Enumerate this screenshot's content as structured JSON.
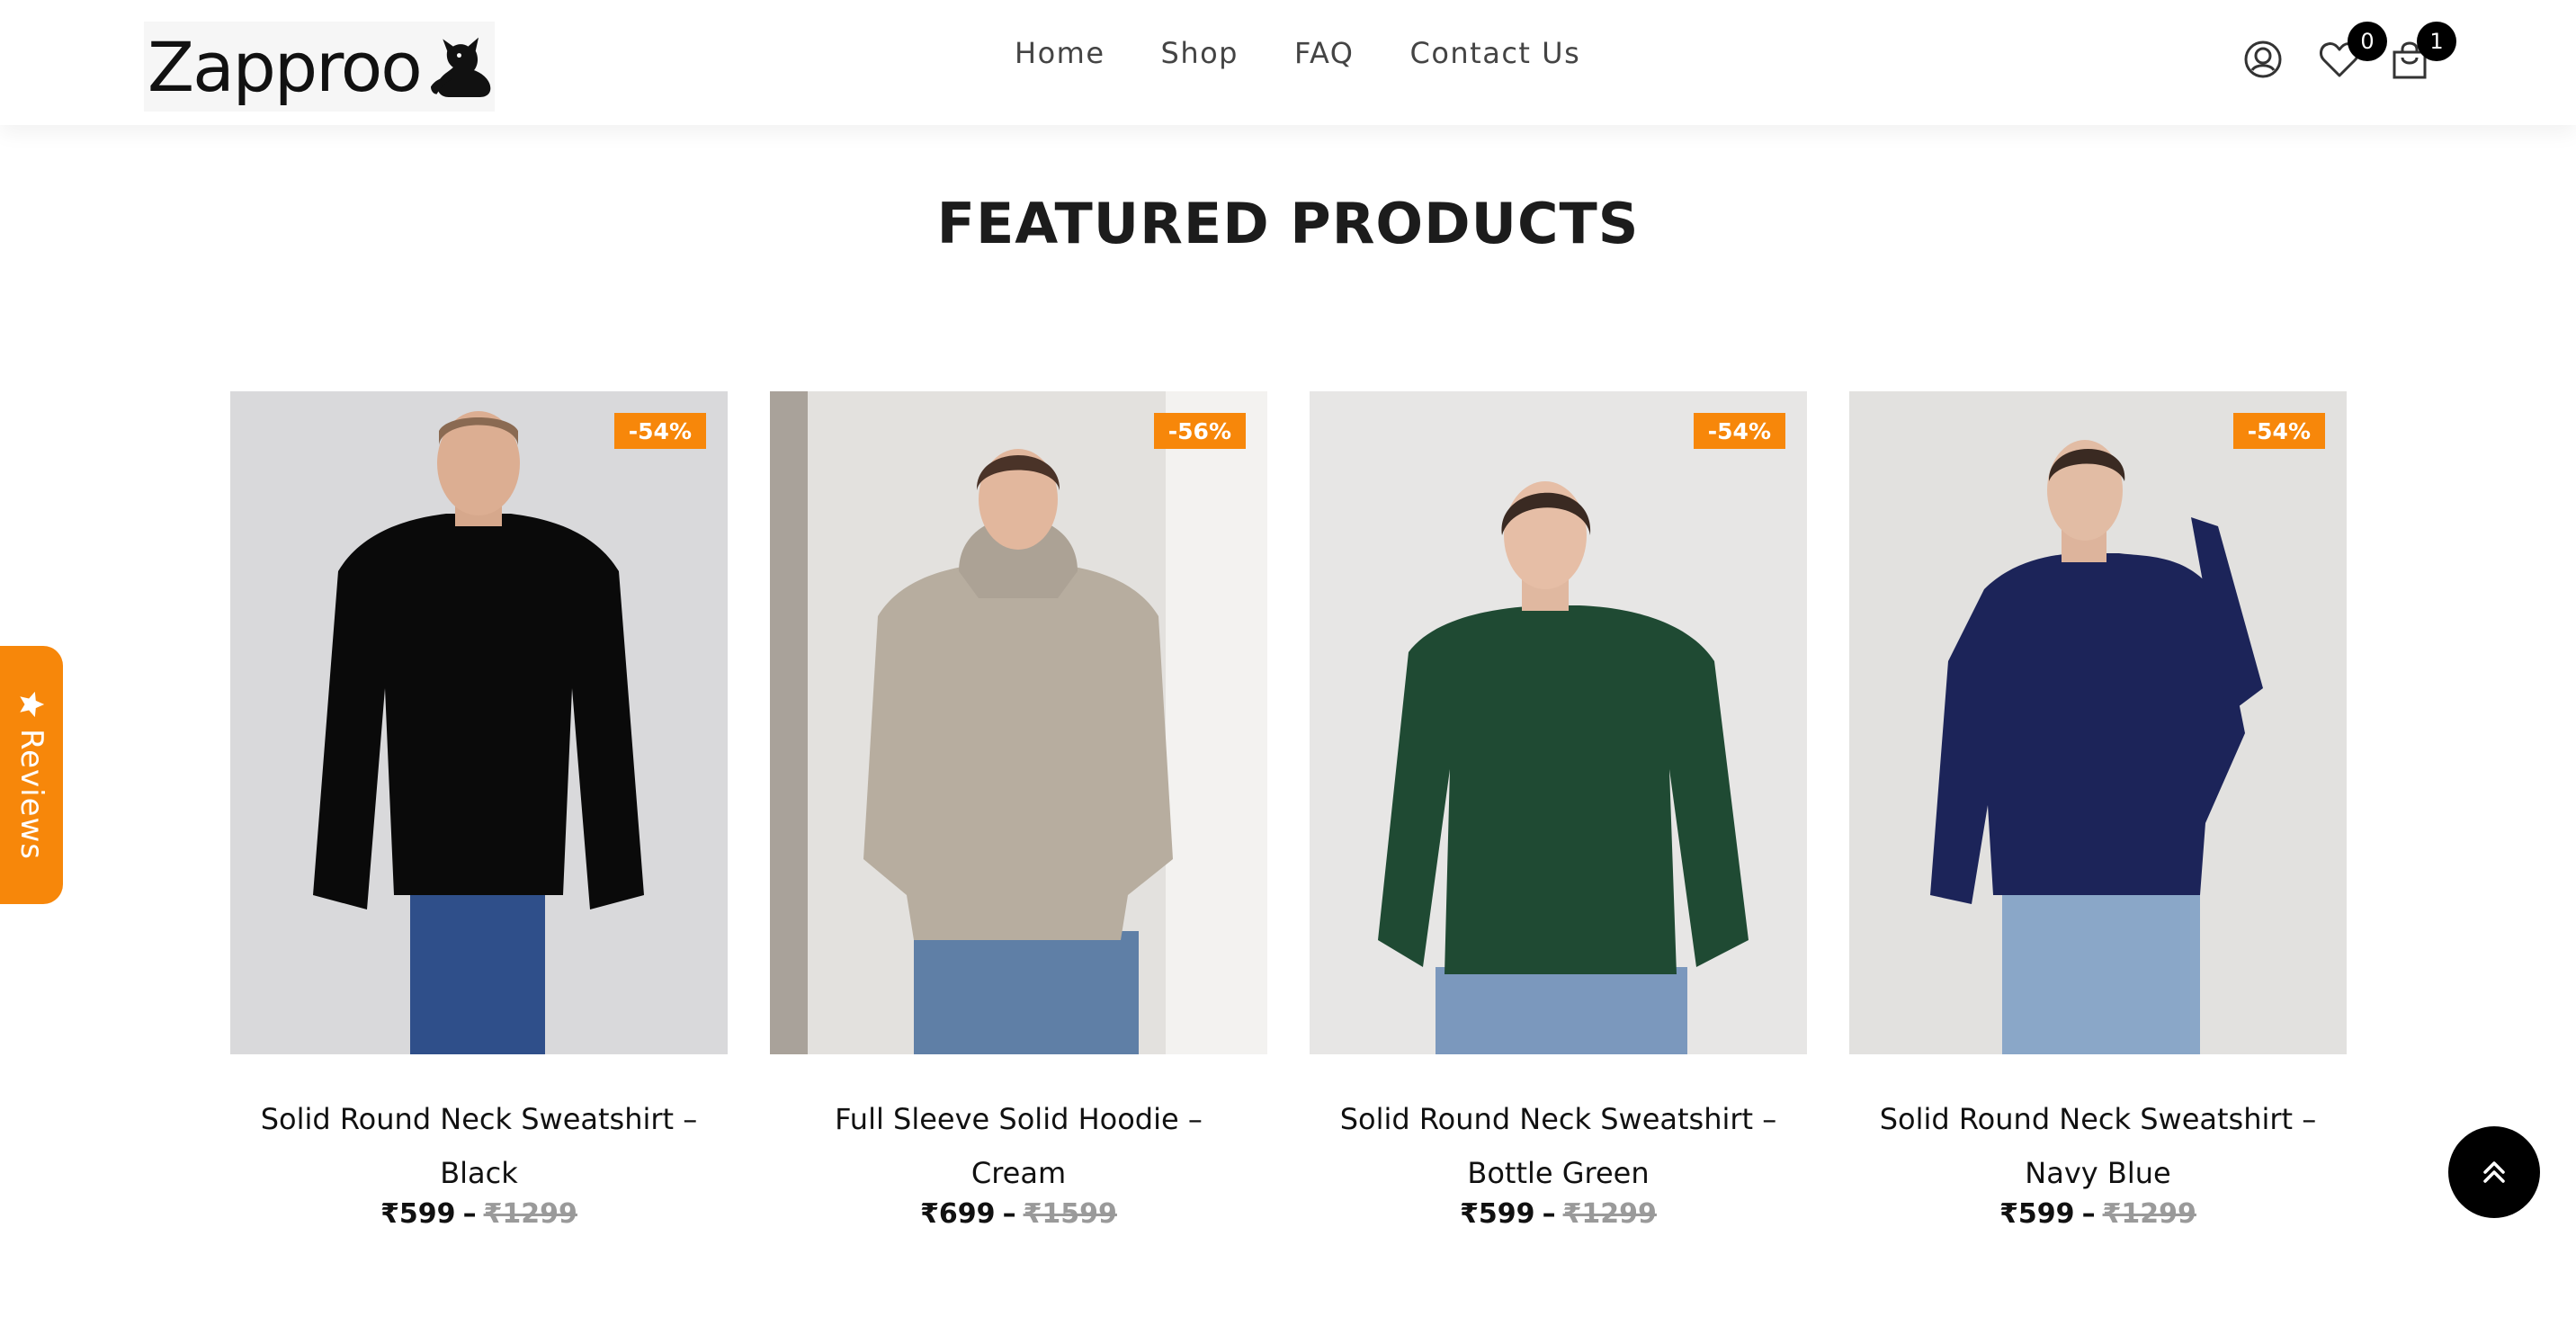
{
  "brand": {
    "name": "Zapproo"
  },
  "nav": {
    "items": [
      {
        "label": "Home"
      },
      {
        "label": "Shop"
      },
      {
        "label": "FAQ"
      },
      {
        "label": "Contact Us"
      }
    ]
  },
  "header_icons": {
    "account": {
      "icon": "user-icon"
    },
    "wishlist": {
      "icon": "heart-icon",
      "count": "0"
    },
    "cart": {
      "icon": "shopping-bag-icon",
      "count": "1"
    }
  },
  "section": {
    "title": "FEATURED PRODUCTS"
  },
  "products": [
    {
      "name": "Solid Round Neck Sweatshirt – Black",
      "sale": "-54%",
      "price": "₹599",
      "separator": "–",
      "old_price": "₹1299",
      "color": "#0a0a0a"
    },
    {
      "name": "Full Sleeve Solid Hoodie – Cream",
      "sale": "-56%",
      "price": "₹699",
      "separator": "–",
      "old_price": "₹1599",
      "color": "#b7ad9f"
    },
    {
      "name": "Solid Round Neck Sweatshirt – Bottle Green",
      "sale": "-54%",
      "price": "₹599",
      "separator": "–",
      "old_price": "₹1299",
      "color": "#1f4a33"
    },
    {
      "name": "Solid Round Neck Sweatshirt – Navy Blue",
      "sale": "-54%",
      "price": "₹599",
      "separator": "–",
      "old_price": "₹1299",
      "color": "#1c2459"
    }
  ],
  "reviews_tab": {
    "label": "Reviews",
    "icon": "star-icon"
  },
  "scroll_top": {
    "icon": "double-chevron-up-icon"
  },
  "colors": {
    "accent": "#f7870a",
    "text": "#1c1c1c",
    "strike": "#9a9a9a"
  }
}
